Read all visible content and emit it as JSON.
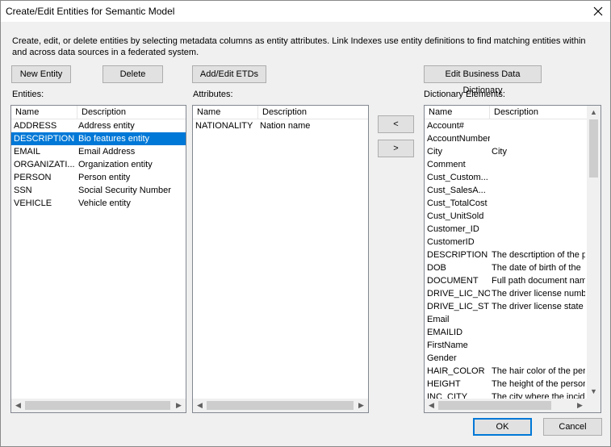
{
  "window": {
    "title": "Create/Edit Entities for Semantic Model",
    "close_icon": "close-icon"
  },
  "description": "Create, edit, or delete entities by selecting metadata columns as entity attributes. Link Indexes use entity definitions to find matching entities within and across data sources in a federated system.",
  "buttons": {
    "new_entity": "New Entity",
    "delete": "Delete",
    "add_edit_etds": "Add/Edit ETDs",
    "edit_dictionary": "Edit Business Data Dictionary",
    "move_left": "<",
    "move_right": ">",
    "ok": "OK",
    "cancel": "Cancel"
  },
  "entities": {
    "label": "Entities:",
    "columns": [
      "Name",
      "Description"
    ],
    "rows": [
      {
        "name": "ADDRESS",
        "desc": "Address entity"
      },
      {
        "name": "DESCRIPTION",
        "desc": "Bio features entity"
      },
      {
        "name": "EMAIL",
        "desc": "Email Address"
      },
      {
        "name": "ORGANIZATI...",
        "desc": "Organization entity"
      },
      {
        "name": "PERSON",
        "desc": "Person entity"
      },
      {
        "name": "SSN",
        "desc": "Social Security Number"
      },
      {
        "name": "VEHICLE",
        "desc": "Vehicle entity"
      }
    ],
    "selected_index": 1
  },
  "attributes": {
    "label": "Attributes:",
    "columns": [
      "Name",
      "Description"
    ],
    "rows": [
      {
        "name": "NATIONALITY",
        "desc": "Nation name"
      }
    ]
  },
  "dictionary": {
    "label": "Dictionary Elements:",
    "columns": [
      "Name",
      "Description"
    ],
    "rows": [
      {
        "name": "Account#",
        "desc": ""
      },
      {
        "name": "AccountNumber",
        "desc": ""
      },
      {
        "name": "City",
        "desc": "City"
      },
      {
        "name": "Comment",
        "desc": ""
      },
      {
        "name": "Cust_Custom...",
        "desc": ""
      },
      {
        "name": "Cust_SalesA...",
        "desc": ""
      },
      {
        "name": "Cust_TotalCost",
        "desc": ""
      },
      {
        "name": "Cust_UnitSold",
        "desc": ""
      },
      {
        "name": "Customer_ID",
        "desc": ""
      },
      {
        "name": "CustomerID",
        "desc": ""
      },
      {
        "name": "DESCRIPTION",
        "desc": "The descrtiption of the p"
      },
      {
        "name": "DOB",
        "desc": "The date of birth of the"
      },
      {
        "name": "DOCUMENT",
        "desc": "Full path document name"
      },
      {
        "name": "DRIVE_LIC_NO",
        "desc": "The driver license numbe"
      },
      {
        "name": "DRIVE_LIC_ST",
        "desc": "The driver license state o"
      },
      {
        "name": "Email",
        "desc": ""
      },
      {
        "name": "EMAILID",
        "desc": ""
      },
      {
        "name": "FirstName",
        "desc": ""
      },
      {
        "name": "Gender",
        "desc": ""
      },
      {
        "name": "HAIR_COLOR",
        "desc": "The hair color of the per"
      },
      {
        "name": "HEIGHT",
        "desc": "The height of the person"
      },
      {
        "name": "INC_CITY",
        "desc": "The city where the incide"
      }
    ]
  },
  "colors": {
    "selection": "#0078d7",
    "button_face": "#e1e1e1",
    "window_bg": "#f0f0f0"
  }
}
